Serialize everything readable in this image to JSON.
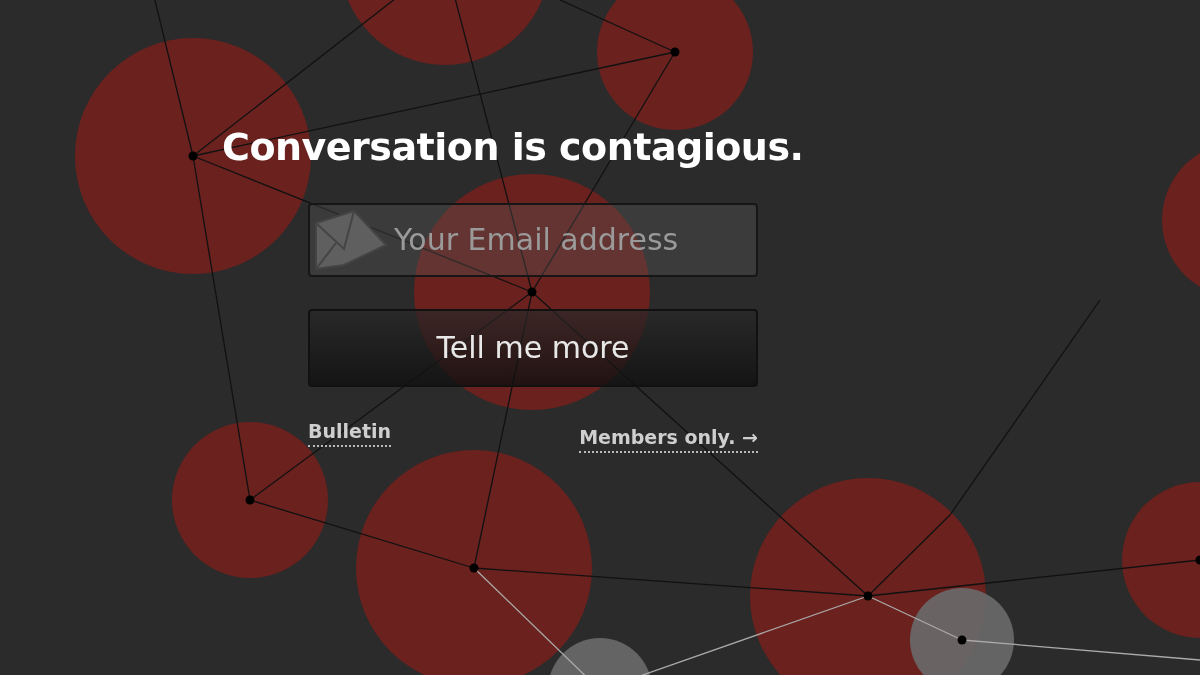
{
  "heading": "Conversation is contagious.",
  "email_field": {
    "placeholder": "Your Email address"
  },
  "submit_button": {
    "label": "Tell me more"
  },
  "links": [
    {
      "label": "Bulletin"
    },
    {
      "label": "Members only. →"
    }
  ]
}
